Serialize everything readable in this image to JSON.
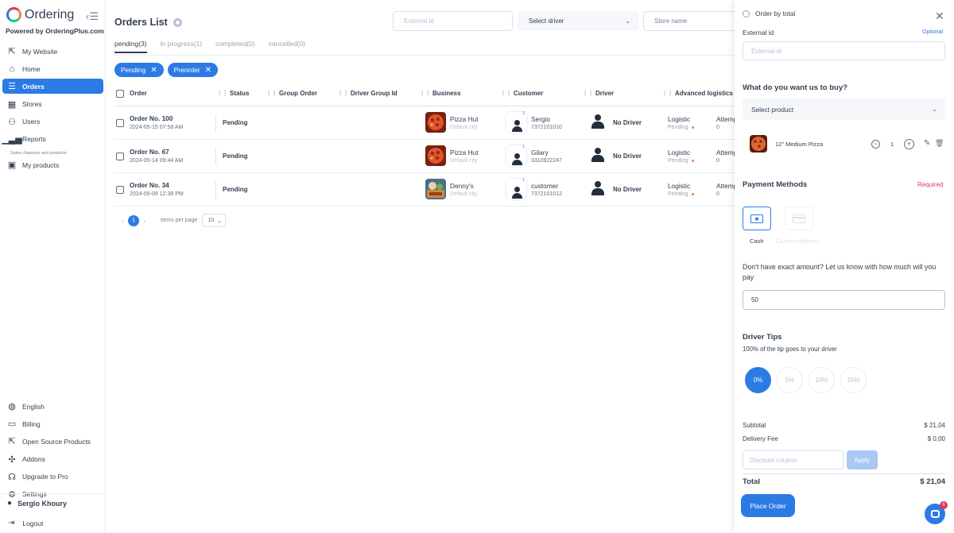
{
  "sidebar": {
    "brand": "Ordering",
    "powered_by": "Powered by OrderingPlus.com",
    "items": [
      {
        "label": "My Website",
        "icon": "external-link-icon"
      },
      {
        "label": "Home",
        "icon": "home-icon"
      },
      {
        "label": "Orders",
        "icon": "list-icon",
        "active": true
      },
      {
        "label": "Stores",
        "icon": "shop-icon"
      },
      {
        "label": "Users",
        "icon": "users-icon"
      },
      {
        "label": "Reports",
        "icon": "bar-chart-icon"
      }
    ],
    "section_label": "Sales channels and products",
    "products_label": "My products",
    "bottom_items": [
      {
        "label": "English",
        "icon": "globe-icon"
      },
      {
        "label": "Billing",
        "icon": "cash-icon"
      },
      {
        "label": "Open Source Products",
        "icon": "external-link-icon"
      },
      {
        "label": "Addons",
        "icon": "puzzle-icon"
      },
      {
        "label": "Upgrade to Pro",
        "icon": "headset-icon"
      },
      {
        "label": "Settings",
        "icon": "gear-icon"
      }
    ],
    "user_name": "Sergio Khoury",
    "logout": "Logout"
  },
  "main": {
    "title": "Orders List",
    "filters": {
      "external_id_placeholder": "External id",
      "driver_select": "Select driver",
      "store_placeholder": "Store name"
    },
    "tabs": [
      "pending(3)",
      "in progress(1)",
      "completed(0)",
      "cancelled(0)"
    ],
    "chips": [
      "Pending",
      "Preorder"
    ],
    "columns": [
      "Order",
      "Status",
      "Group Order",
      "Driver Group Id",
      "Business",
      "Customer",
      "Driver",
      "Advanced logistics"
    ],
    "rows": [
      {
        "order": "Order No. 100",
        "date": "2024-05-15 07:58 AM",
        "status": "Pending",
        "business": "Pizza Hut",
        "city": "Default city",
        "customer": "Sergio",
        "phone": "7372101010",
        "badge": "2",
        "driver": "No Driver",
        "logistic": "Logistic",
        "logistic_status": "Pending",
        "attempt": "Attempt",
        "attempt_value": "0"
      },
      {
        "order": "Order No. 67",
        "date": "2024-05-14 09:44 AM",
        "status": "Pending",
        "business": "Pizza Hut",
        "city": "Default city",
        "customer": "Gilary",
        "phone": "3310922247",
        "badge": "1",
        "driver": "No Driver",
        "logistic": "Logistic",
        "logistic_status": "Pending",
        "attempt": "Attempt",
        "attempt_value": "0"
      },
      {
        "order": "Order No. 34",
        "date": "2024-05-09 12:38 PM",
        "status": "Pending",
        "business": "Denny's",
        "city": "Default city",
        "customer": "customer",
        "phone": "7372101012",
        "badge": "1",
        "driver": "No Driver",
        "logistic": "Logistic",
        "logistic_status": "Pending",
        "attempt": "Attempt",
        "attempt_value": "0"
      }
    ],
    "pagination": {
      "prev": "‹",
      "page": "1",
      "next": "›",
      "items_per_page_label": "items per page",
      "items_per_page": "10"
    }
  },
  "panel": {
    "order_by_total": "Order by total",
    "external_id_label": "External id",
    "optional": "Optional",
    "external_id_placeholder": "External id",
    "buy_title": "What do you want us to buy?",
    "select_product": "Select product",
    "product_name": "12\" Medium Pizza",
    "product_qty": "1",
    "payment_title": "Payment Methods",
    "required": "Required",
    "pay_cash": "Cash",
    "pay_card": "Card on delivery",
    "exact_amount_text": "Don't have exact amount? Let us know with how much will you pay",
    "amount_value": "50",
    "tips_title": "Driver Tips",
    "tips_sub": "100% of the tip goes to your driver",
    "tips": [
      "0%",
      "5%",
      "10%",
      "15%"
    ],
    "subtotal_label": "Subtotal",
    "subtotal_value": "$ 21,04",
    "delivery_label": "Delivery Fee",
    "delivery_value": "$ 0,00",
    "coupon_placeholder": "Discount coupon",
    "apply": "Apply",
    "total_label": "Total",
    "total_value": "$ 21,04",
    "place_order": "Place Order",
    "chat_badge": "6"
  },
  "colors": {
    "accent": "#2c7be5",
    "required": "#e63757",
    "pending_dot": "#f5803e"
  }
}
